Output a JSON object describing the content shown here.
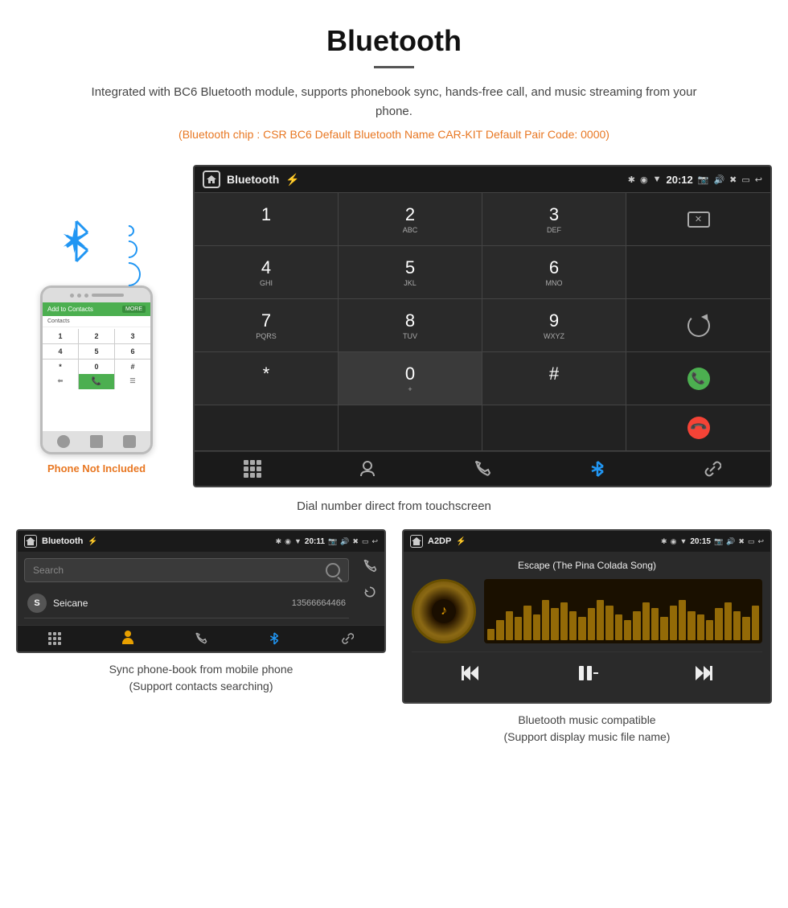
{
  "header": {
    "title": "Bluetooth",
    "description": "Integrated with BC6 Bluetooth module, supports phonebook sync, hands-free call, and music streaming from your phone.",
    "info_line": "(Bluetooth chip : CSR BC6    Default Bluetooth Name CAR-KIT    Default Pair Code: 0000)"
  },
  "main_screen": {
    "status_bar": {
      "title": "Bluetooth",
      "time": "20:12"
    },
    "dialpad": {
      "keys": [
        {
          "num": "1",
          "sub": ""
        },
        {
          "num": "2",
          "sub": "ABC"
        },
        {
          "num": "3",
          "sub": "DEF"
        },
        {
          "num": "4",
          "sub": "GHI"
        },
        {
          "num": "5",
          "sub": "JKL"
        },
        {
          "num": "6",
          "sub": "MNO"
        },
        {
          "num": "7",
          "sub": "PQRS"
        },
        {
          "num": "8",
          "sub": "TUV"
        },
        {
          "num": "9",
          "sub": "WXYZ"
        },
        {
          "num": "*",
          "sub": ""
        },
        {
          "num": "0",
          "sub": "+"
        },
        {
          "num": "#",
          "sub": ""
        }
      ]
    },
    "caption": "Dial number direct from touchscreen"
  },
  "phone": {
    "not_included": "Phone Not Included"
  },
  "phonebook_screen": {
    "status_bar": {
      "title": "Bluetooth",
      "time": "20:11"
    },
    "search_placeholder": "Search",
    "contacts": [
      {
        "letter": "S",
        "name": "Seicane",
        "number": "13566664466"
      }
    ],
    "caption_line1": "Sync phone-book from mobile phone",
    "caption_line2": "(Support contacts searching)"
  },
  "music_screen": {
    "status_bar": {
      "title": "A2DP",
      "time": "20:15"
    },
    "song_title": "Escape (The Pina Colada Song)",
    "waveform_heights": [
      20,
      35,
      50,
      40,
      60,
      45,
      70,
      55,
      65,
      50,
      40,
      55,
      70,
      60,
      45,
      35,
      50,
      65,
      55,
      40,
      60,
      70,
      50,
      45,
      35,
      55,
      65,
      50,
      40,
      60
    ],
    "caption_line1": "Bluetooth music compatible",
    "caption_line2": "(Support display music file name)"
  }
}
